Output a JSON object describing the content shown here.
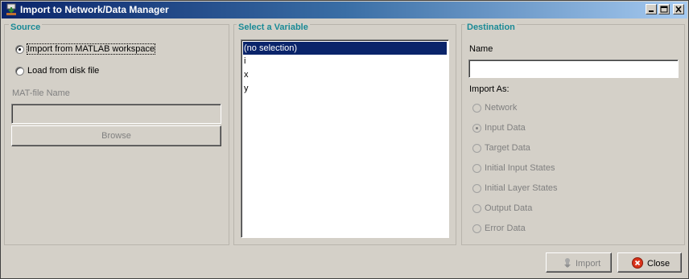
{
  "window": {
    "title": "Import to Network/Data Manager",
    "icon": "matlab-download-icon"
  },
  "source": {
    "title": "Source",
    "options": [
      {
        "label": "Import from MATLAB workspace",
        "selected": true
      },
      {
        "label": "Load from disk file",
        "selected": false
      }
    ],
    "mat_file_label": "MAT-file Name",
    "mat_file_value": "",
    "browse_label": "Browse"
  },
  "variable": {
    "title": "Select a Variable",
    "items": [
      "(no selection)",
      "i",
      "x",
      "y"
    ],
    "selected_index": 0
  },
  "destination": {
    "title": "Destination",
    "name_label": "Name",
    "name_value": "",
    "import_as_label": "Import As:",
    "options": [
      {
        "label": "Network",
        "selected": false
      },
      {
        "label": "Input Data",
        "selected": true
      },
      {
        "label": "Target Data",
        "selected": false
      },
      {
        "label": "Initial Input States",
        "selected": false
      },
      {
        "label": "Initial Layer States",
        "selected": false
      },
      {
        "label": "Output Data",
        "selected": false
      },
      {
        "label": "Error Data",
        "selected": false
      }
    ]
  },
  "footer": {
    "import_label": "Import",
    "close_label": "Close"
  },
  "colors": {
    "section_title": "#1a8a96",
    "selection": "#0a246a",
    "close_icon": "#d9331a"
  }
}
